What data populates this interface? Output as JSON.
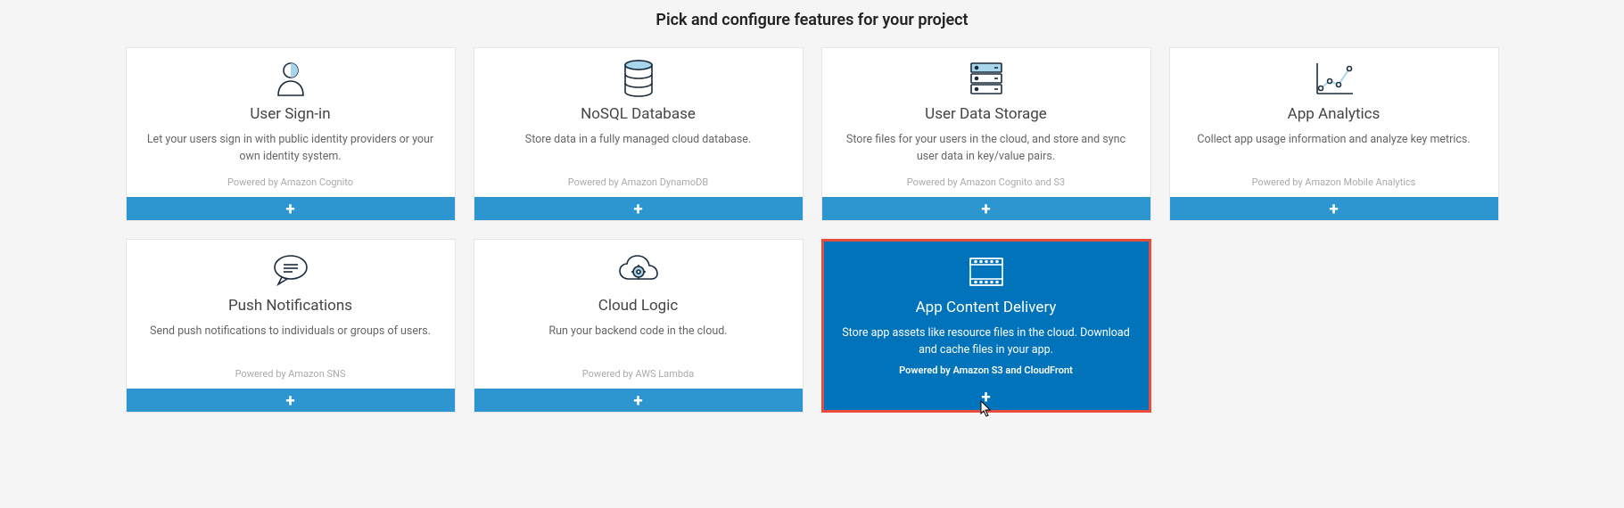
{
  "page": {
    "title": "Pick and configure features for your project"
  },
  "cards": [
    {
      "icon": "user-icon",
      "title": "User Sign-in",
      "desc": "Let your users sign in with public identity providers or your own identity system.",
      "powered": "Powered by Amazon Cognito",
      "selected": false
    },
    {
      "icon": "database-icon",
      "title": "NoSQL Database",
      "desc": "Store data in a fully managed cloud database.",
      "powered": "Powered by Amazon DynamoDB",
      "selected": false
    },
    {
      "icon": "storage-icon",
      "title": "User Data Storage",
      "desc": "Store files for your users in the cloud, and store and sync user data in key/value pairs.",
      "powered": "Powered by Amazon Cognito and S3",
      "selected": false
    },
    {
      "icon": "analytics-icon",
      "title": "App Analytics",
      "desc": "Collect app usage information and analyze key metrics.",
      "powered": "Powered by Amazon Mobile Analytics",
      "selected": false
    },
    {
      "icon": "notifications-icon",
      "title": "Push Notifications",
      "desc": "Send push notifications to individuals or groups of users.",
      "powered": "Powered by Amazon SNS",
      "selected": false
    },
    {
      "icon": "cloud-logic-icon",
      "title": "Cloud Logic",
      "desc": "Run your backend code in the cloud.",
      "powered": "Powered by AWS Lambda",
      "selected": false
    },
    {
      "icon": "content-delivery-icon",
      "title": "App Content Delivery",
      "desc": "Store app assets like resource files in the cloud. Download and cache files in your app.",
      "powered": "Powered by Amazon S3 and CloudFront",
      "selected": true
    }
  ]
}
